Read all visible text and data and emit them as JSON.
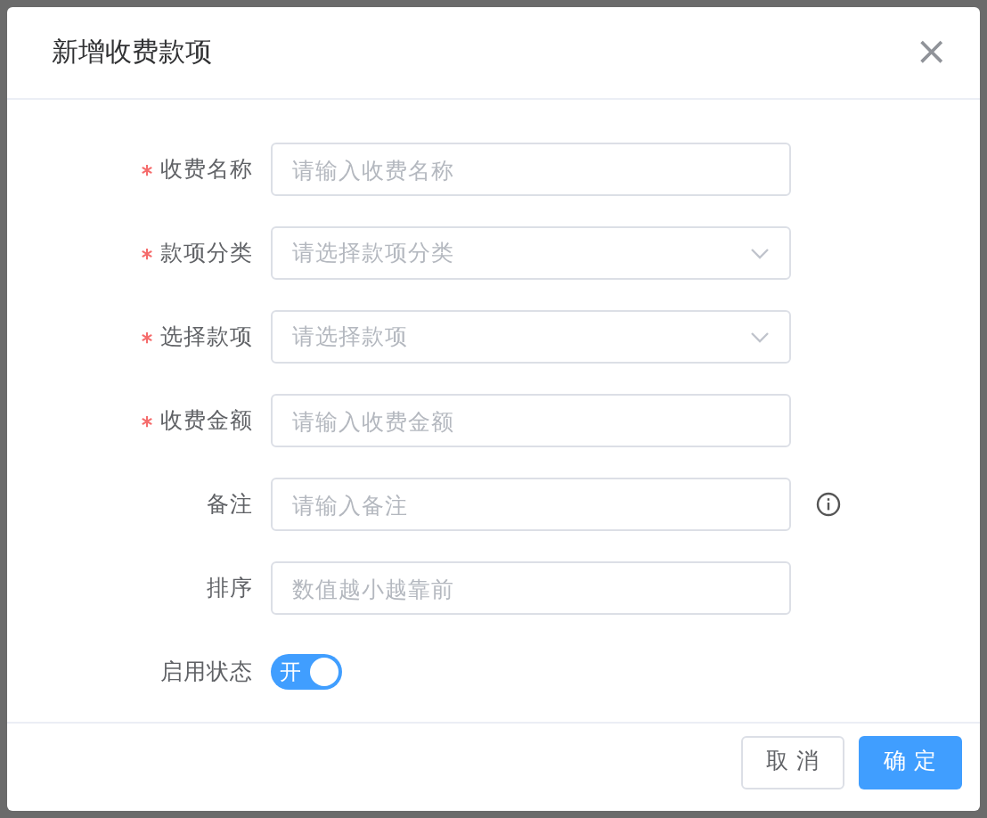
{
  "dialog": {
    "title": "新增收费款项",
    "close": "×"
  },
  "fields": [
    {
      "kind": "input",
      "label": "收费名称",
      "required": true,
      "placeholder": "请输入收费名称",
      "info": false
    },
    {
      "kind": "select",
      "label": "款项分类",
      "required": true,
      "placeholder": "请选择款项分类",
      "info": false
    },
    {
      "kind": "select",
      "label": "选择款项",
      "required": true,
      "placeholder": "请选择款项",
      "info": false
    },
    {
      "kind": "input",
      "label": "收费金额",
      "required": true,
      "placeholder": "请输入收费金额",
      "info": false
    },
    {
      "kind": "input",
      "label": "备注",
      "required": false,
      "placeholder": "请输入备注",
      "info": true
    },
    {
      "kind": "input",
      "label": "排序",
      "required": false,
      "placeholder": "数值越小越靠前",
      "info": false
    },
    {
      "kind": "toggle",
      "label": "启用状态",
      "required": false,
      "on": true,
      "text": "开"
    }
  ],
  "buttons": [
    {
      "label": "取 消",
      "primary": false
    },
    {
      "label": "确 定",
      "primary": true
    }
  ]
}
